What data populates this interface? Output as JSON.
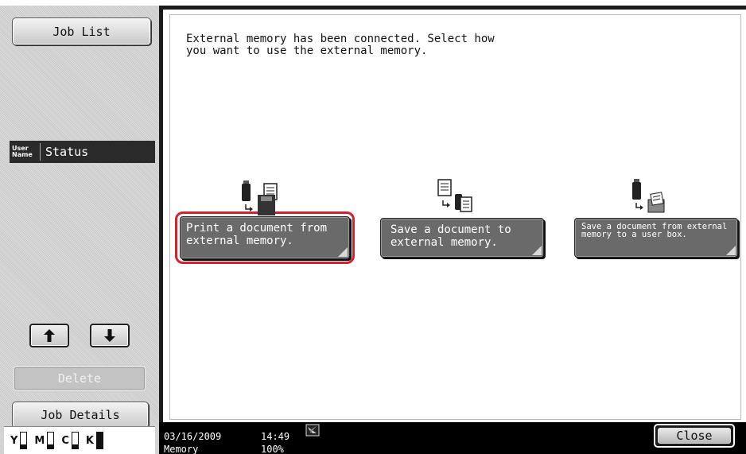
{
  "sidebar": {
    "job_list_label": "Job List",
    "table_header": {
      "user_name": "User\nName",
      "status": "Status"
    },
    "delete_label": "Delete",
    "job_details_label": "Job Details",
    "toner": [
      {
        "letter": "Y",
        "level": 0.25
      },
      {
        "letter": "M",
        "level": 0.25
      },
      {
        "letter": "C",
        "level": 0.25
      },
      {
        "letter": "K",
        "level": 1.0
      }
    ]
  },
  "main": {
    "message": "External memory has been connected. Select how\nyou want to use the external memory.",
    "options": [
      {
        "label": "Print a document from external memory.",
        "icon": "usb-to-printer-icon",
        "selected": true
      },
      {
        "label": "Save a document to external memory.",
        "icon": "document-to-usb-icon",
        "selected": false
      },
      {
        "label": "Save a document from external memory to a user box.",
        "icon": "usb-to-user-box-icon",
        "selected": false
      }
    ]
  },
  "statusbar": {
    "date": "03/16/2009",
    "time": "14:49",
    "memory_label": "Memory",
    "memory_percent": "100%",
    "icon": "network-status-icon",
    "close_label": "Close"
  },
  "colors": {
    "highlight": "#d8202a",
    "option_button": "#6a6a6a",
    "statusbar": "#000000"
  }
}
